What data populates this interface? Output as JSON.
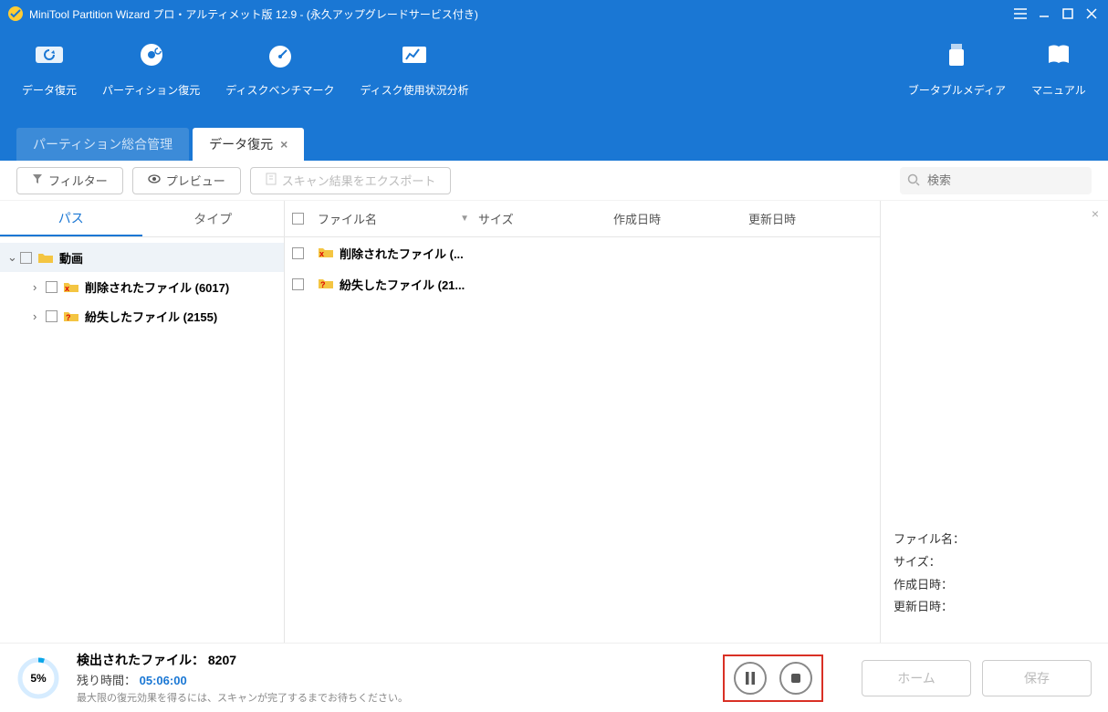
{
  "titlebar": {
    "title": "MiniTool Partition Wizard プロ・アルティメット版 12.9 - (永久アップグレードサービス付き)"
  },
  "toolbar": {
    "items": [
      {
        "label": "データ復元"
      },
      {
        "label": "パーティション復元"
      },
      {
        "label": "ディスクベンチマーク"
      },
      {
        "label": "ディスク使用状況分析"
      }
    ],
    "right_items": [
      {
        "label": "ブータブルメディア"
      },
      {
        "label": "マニュアル"
      }
    ]
  },
  "main_tabs": {
    "tab1": "パーティション総合管理",
    "tab2": "データ復元"
  },
  "actions": {
    "filter": "フィルター",
    "preview": "プレビュー",
    "export": "スキャン結果をエクスポート"
  },
  "search": {
    "placeholder": "検索"
  },
  "subtabs": {
    "path": "パス",
    "type": "タイプ"
  },
  "tree": {
    "root": "動画",
    "n1": "削除されたファイル (6017)",
    "n2": "紛失したファイル (2155)"
  },
  "columns": {
    "c1": "ファイル名",
    "c2": "サイズ",
    "c3": "作成日時",
    "c4": "更新日時"
  },
  "rows": {
    "r1": "削除されたファイル (...",
    "r2": "紛失したファイル (21..."
  },
  "info_labels": {
    "name": "ファイル名：",
    "size": "サイズ：",
    "created": "作成日時：",
    "modified": "更新日時："
  },
  "footer": {
    "pct": "5%",
    "found_label": "検出されたファイル：",
    "found_count": "8207",
    "remain_label": "残り時間：",
    "remain_value": "05:06:00",
    "hint": "最大限の復元効果を得るには、スキャンが完了するまでお待ちください。",
    "home": "ホーム",
    "save": "保存"
  }
}
